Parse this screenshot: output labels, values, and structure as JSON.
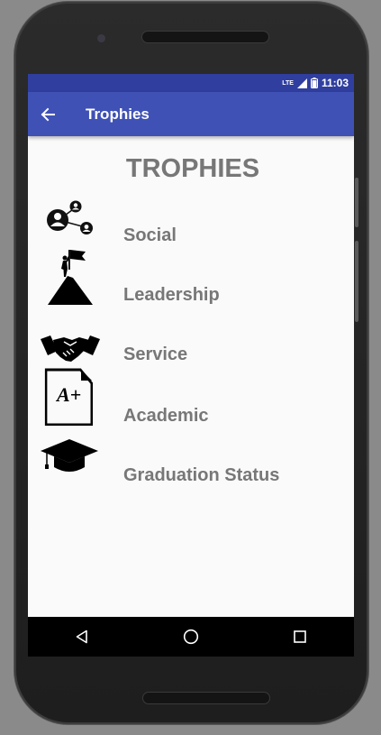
{
  "status_bar": {
    "network": "LTE",
    "time": "11:03"
  },
  "toolbar": {
    "title": "Trophies"
  },
  "page": {
    "heading": "TROPHIES",
    "items": [
      {
        "label": "Social",
        "icon": "social-network-icon"
      },
      {
        "label": "Leadership",
        "icon": "mountain-flag-icon"
      },
      {
        "label": "Service",
        "icon": "handshake-icon"
      },
      {
        "label": "Academic",
        "icon": "a-plus-document-icon"
      },
      {
        "label": "Graduation Status",
        "icon": "graduation-cap-icon"
      }
    ]
  },
  "colors": {
    "status_bar": "#303f9f",
    "toolbar": "#3f51b5",
    "text": "#777777",
    "background": "#fafafa"
  }
}
